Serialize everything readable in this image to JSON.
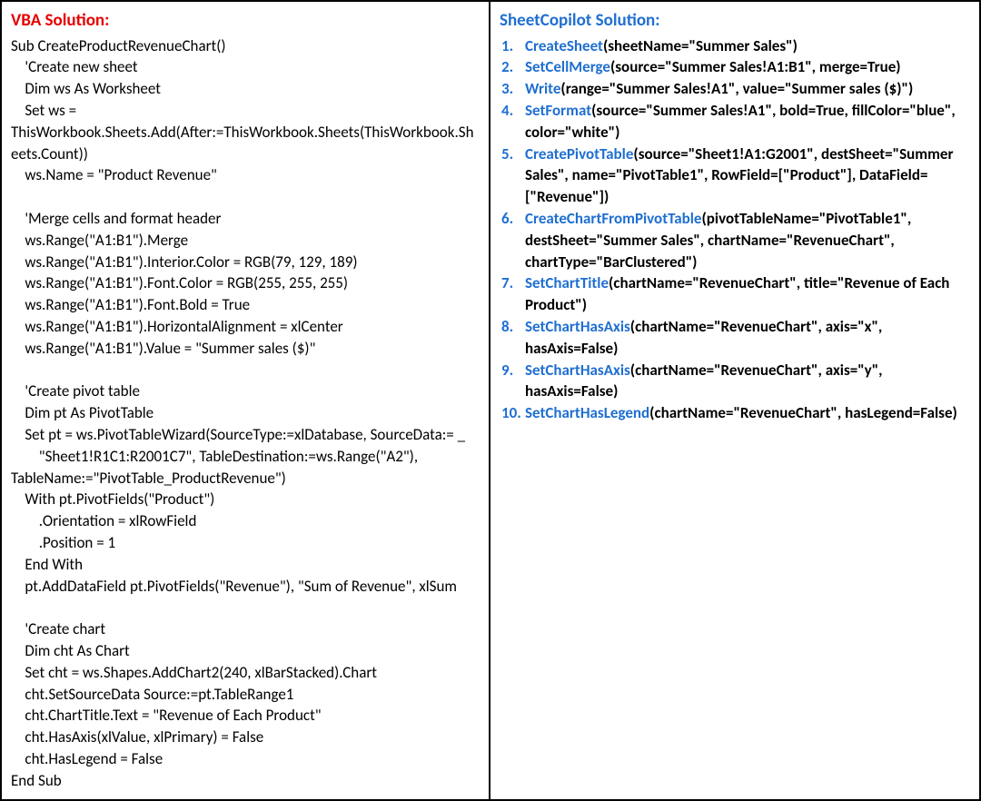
{
  "left": {
    "title": "VBA Solution:",
    "code": "Sub CreateProductRevenueChart()\n    'Create new sheet\n    Dim ws As Worksheet\n    Set ws = \nThisWorkbook.Sheets.Add(After:=ThisWorkbook.Sheets(ThisWorkbook.Sheets.Count))\n    ws.Name = \"Product Revenue\"\n\n    'Merge cells and format header\n    ws.Range(\"A1:B1\").Merge\n    ws.Range(\"A1:B1\").Interior.Color = RGB(79, 129, 189)\n    ws.Range(\"A1:B1\").Font.Color = RGB(255, 255, 255)\n    ws.Range(\"A1:B1\").Font.Bold = True\n    ws.Range(\"A1:B1\").HorizontalAlignment = xlCenter\n    ws.Range(\"A1:B1\").Value = \"Summer sales ($)\"\n\n    'Create pivot table\n    Dim pt As PivotTable\n    Set pt = ws.PivotTableWizard(SourceType:=xlDatabase, SourceData:= _\n        \"Sheet1!R1C1:R2001C7\", TableDestination:=ws.Range(\"A2\"), TableName:=\"PivotTable_ProductRevenue\")\n    With pt.PivotFields(\"Product\")\n        .Orientation = xlRowField\n        .Position = 1\n    End With\n    pt.AddDataField pt.PivotFields(\"Revenue\"), \"Sum of Revenue\", xlSum\n\n    'Create chart\n    Dim cht As Chart\n    Set cht = ws.Shapes.AddChart2(240, xlBarStacked).Chart\n    cht.SetSourceData Source:=pt.TableRange1\n    cht.ChartTitle.Text = \"Revenue of Each Product\"\n    cht.HasAxis(xlValue, xlPrimary) = False\n    cht.HasLegend = False\nEnd Sub"
  },
  "right": {
    "title": "SheetCopilot Solution:",
    "steps": [
      {
        "n": "1.",
        "fn": "CreateSheet",
        "args": "(sheetName=\"Summer Sales\")"
      },
      {
        "n": "2.",
        "fn": "SetCellMerge",
        "args": "(source=\"Summer Sales!A1:B1\", merge=True)"
      },
      {
        "n": "3.",
        "fn": "Write",
        "args": "(range=\"Summer Sales!A1\", value=\"Summer sales ($)\")"
      },
      {
        "n": "4.",
        "fn": "SetFormat",
        "args": "(source=\"Summer Sales!A1\", bold=True, fillColor=\"blue\", color=\"white\")"
      },
      {
        "n": "5.",
        "fn": "CreatePivotTable",
        "args": "(source=\"Sheet1!A1:G2001\", destSheet=\"Summer Sales\", name=\"PivotTable1\", RowField=[\"Product\"], DataField=[\"Revenue\"])"
      },
      {
        "n": "6.",
        "fn": "CreateChartFromPivotTable",
        "args": "(pivotTableName=\"PivotTable1\", destSheet=\"Summer Sales\", chartName=\"RevenueChart\", chartType=\"BarClustered\")"
      },
      {
        "n": "7.",
        "fn": "SetChartTitle",
        "args": "(chartName=\"RevenueChart\", title=\"Revenue of Each Product\")"
      },
      {
        "n": "8.",
        "fn": "SetChartHasAxis",
        "args": "(chartName=\"RevenueChart\", axis=\"x\", hasAxis=False)"
      },
      {
        "n": "9.",
        "fn": "SetChartHasAxis",
        "args": "(chartName=\"RevenueChart\", axis=\"y\", hasAxis=False)"
      },
      {
        "n": "10.",
        "fn": "SetChartHasLegend",
        "args": "(chartName=\"RevenueChart\", hasLegend=False)"
      }
    ]
  }
}
